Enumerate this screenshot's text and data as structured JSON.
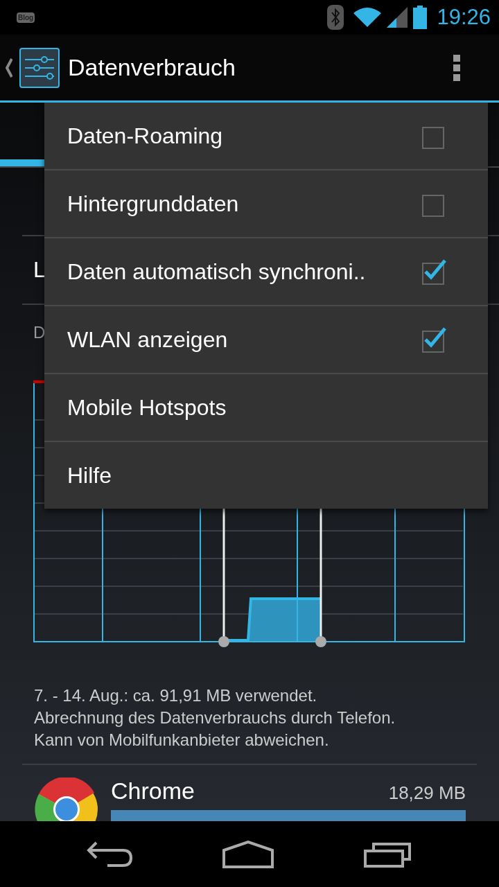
{
  "status_bar": {
    "notification": "Blog",
    "time": "19:26"
  },
  "action_bar": {
    "title": "Datenverbrauch"
  },
  "settings_rows": [
    {
      "label": "L"
    }
  ],
  "cycle_label": "D",
  "summary": [
    "7. - 14. Aug.: ca. 91,91 MB verwendet.",
    "Abrechnung des Datenverbrauchs durch Telefon.",
    "Kann von Mobilfunkanbieter abweichen."
  ],
  "apps": [
    {
      "name": "Chrome",
      "usage": "18,29 MB",
      "level": 1
    }
  ],
  "menu": [
    {
      "label": "Daten-Roaming",
      "kind": "checkbox",
      "checked": false
    },
    {
      "label": "Hintergrunddaten",
      "kind": "checkbox",
      "checked": false
    },
    {
      "label": "Daten automatisch synchroni..",
      "kind": "checkbox",
      "checked": true
    },
    {
      "label": "WLAN anzeigen",
      "kind": "checkbox",
      "checked": true
    },
    {
      "label": "Mobile Hotspots",
      "kind": "plain"
    },
    {
      "label": "Hilfe",
      "kind": "plain"
    }
  ]
}
